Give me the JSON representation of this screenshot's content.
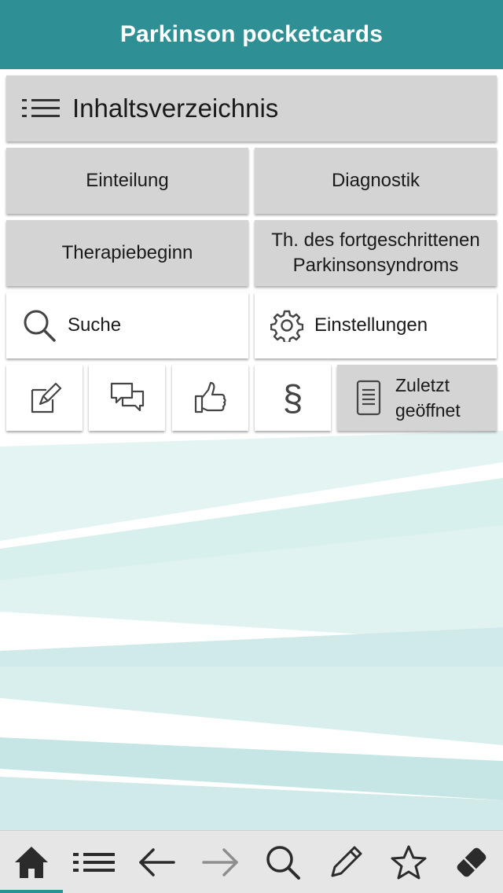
{
  "header": {
    "title": "Parkinson pocketcards"
  },
  "menu": {
    "toc_label": "Inhaltsverzeichnis",
    "einteilung": "Einteilung",
    "diagnostik": "Diagnostik",
    "therapiebeginn": "Therapiebeginn",
    "fortgeschritten_line1": "Th. des fortgeschrittenen",
    "fortgeschritten_line2": "Parkinsonsyndroms",
    "suche": "Suche",
    "einstellungen": "Einstellungen",
    "paragraph_symbol": "§",
    "recent_line1": "Zuletzt",
    "recent_line2": "geöffnet"
  },
  "icons": {
    "toc": "list-icon",
    "search": "search-icon",
    "settings": "gear-icon",
    "notes": "edit-note-icon",
    "feedback": "chat-bubbles-icon",
    "rate": "thumbs-up-icon",
    "legal": "paragraph-icon",
    "recent": "document-icon"
  },
  "tabbar": {
    "items": [
      "home-icon",
      "list-icon",
      "arrow-left-icon",
      "arrow-right-icon",
      "search-icon",
      "pencil-icon",
      "star-icon",
      "eraser-icon"
    ],
    "active": "home-icon"
  },
  "colors": {
    "primary": "#2e9094",
    "tile": "#d4d4d4",
    "tabbar": "#e6e6e6",
    "wave": "#cdeae8"
  }
}
